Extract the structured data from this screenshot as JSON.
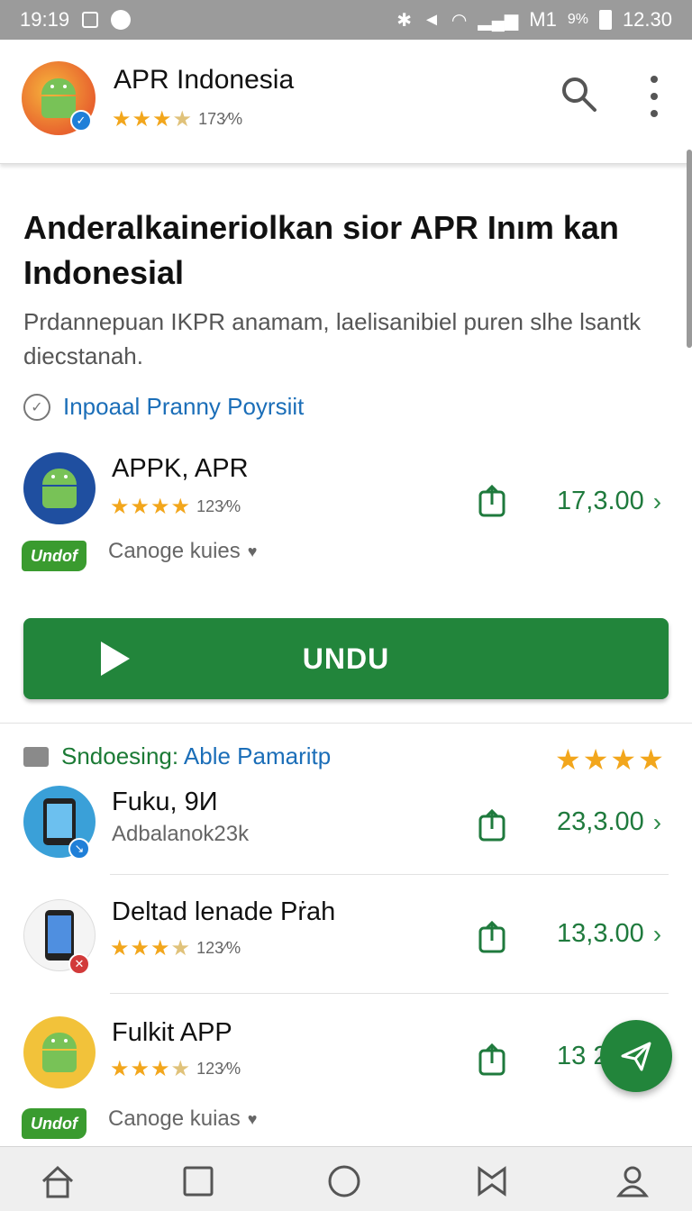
{
  "status_bar": {
    "time_left": "19:19",
    "network": "M1",
    "battery": "9%",
    "time_right": "12.30"
  },
  "app_bar": {
    "title": "APR Indonesia",
    "rating_text": "173⁄%",
    "icons": [
      "search-icon",
      "more-vert-icon"
    ]
  },
  "headline": "Anderalkaineriolkan sior APR Inım kan Indonesial",
  "subtext": "Prdannepuan IKPR anamam, laelisanibiel puren slhe lsantk diecstanah.",
  "policy_link": "Inpoaal Pranny Poyrsiit",
  "featured_app": {
    "title": "APPK, APR",
    "rating_text": "123⁄%",
    "price": "17,3.00",
    "badge": "Undof",
    "sub_label": "Canoge kuies"
  },
  "install_button": {
    "label": "UNDU"
  },
  "section": {
    "title_green": "Sndoesing:",
    "title_blue": " Able Pamaritp"
  },
  "list": [
    {
      "title": "Fuku, 9И",
      "subtitle": "Adbalanok23k",
      "price": "23,3.00"
    },
    {
      "title": "Deltad lenade Pṙah",
      "rating_text": "123⁄%",
      "price": "13,3.00"
    },
    {
      "title": "Fulkit APP",
      "rating_text": "123⁄%",
      "price": "13 2",
      "badge": "Undof",
      "sub_label": "Canoge kuias"
    }
  ],
  "colors": {
    "accent_green": "#22853b",
    "link_blue": "#1b6eb8",
    "star": "#f2a61c",
    "status_bar": "#9b9b9b"
  }
}
